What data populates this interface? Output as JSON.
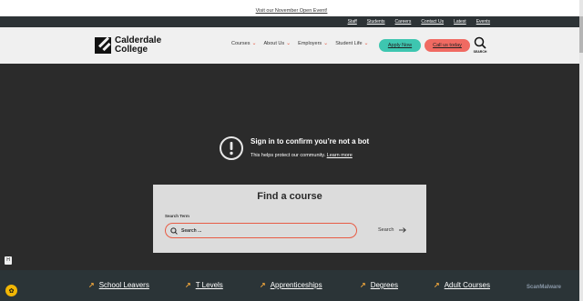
{
  "announcement": {
    "text": "Visit our November Open Event!"
  },
  "topbar": {
    "links": [
      "Staff",
      "Students",
      "Careers",
      "Contact Us",
      "Latest",
      "Events"
    ]
  },
  "logo": {
    "line1": "Calderdale",
    "line2": "College"
  },
  "nav": {
    "items": [
      "Courses",
      "About Us",
      "Employers",
      "Student Life"
    ],
    "apply_label": "Apply Now",
    "call_label": "Call us today",
    "search_label": "SEARCH"
  },
  "bot_check": {
    "title": "Sign in to confirm you’re not a bot",
    "subtitle": "This helps protect our community.",
    "learn_more": "Learn more"
  },
  "find_course": {
    "heading": "Find a course",
    "field_label": "Search Term",
    "placeholder": "Search ...",
    "button_label": "Search"
  },
  "side_badge": "H",
  "quick_links": [
    "School Leavers",
    "T Levels",
    "Apprenticeships",
    "Degrees",
    "Adult Courses"
  ],
  "watermark": "ScanMalware",
  "colors": {
    "accent_red": "#e85c45",
    "teal": "#3ec6b0",
    "coral": "#f06a62",
    "arrow_yellow": "#e9a23b"
  }
}
